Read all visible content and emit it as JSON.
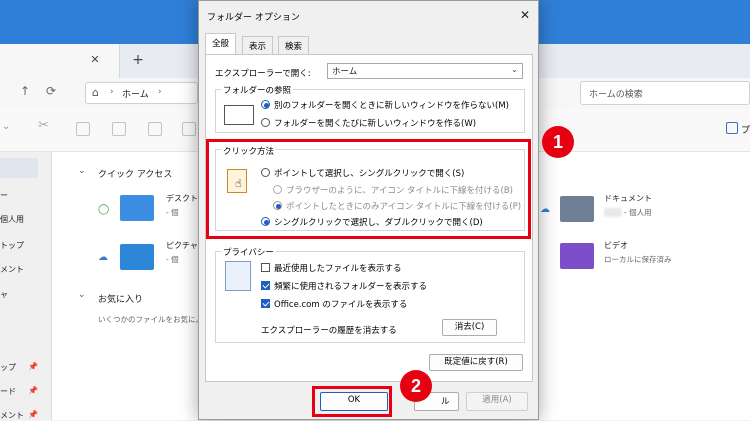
{
  "explorer": {
    "home": "ホーム",
    "search_placeholder": "ホームの検索",
    "sidebar": [
      {
        "label": "ー"
      },
      {
        "label": "個人用"
      },
      {
        "label": "トップ"
      },
      {
        "label": "メント"
      },
      {
        "label": "ャ"
      },
      {
        "label": "ップ"
      },
      {
        "label": "ード"
      },
      {
        "label": "メント"
      }
    ],
    "quick_access": "クイック アクセス",
    "favorites": "お気に入り",
    "favorites_hint": "いくつかのファイルをお気に入りに追加すると、ここに表示されます。",
    "items": {
      "desktop": {
        "name": "デスクトップ",
        "sub": "- 個"
      },
      "pictures": {
        "name": "ピクチャ",
        "sub": "- 個"
      },
      "documents": {
        "name": "ドキュメント",
        "sub": "- 個人用"
      },
      "videos": {
        "name": "ビデオ",
        "sub": "ローカルに保存済み"
      }
    },
    "toolbar_right": "プ"
  },
  "dialog": {
    "title": "フォルダー オプション",
    "tabs": [
      "全般",
      "表示",
      "検索"
    ],
    "open_explorer_label": "エクスプローラーで開く:",
    "open_explorer_value": "ホーム",
    "browse": {
      "title": "フォルダーの参照",
      "options": [
        {
          "label": "別のフォルダーを開くときに新しいウィンドウを作らない(M)",
          "checked": true
        },
        {
          "label": "フォルダーを開くたびに新しいウィンドウを作る(W)",
          "checked": false
        }
      ]
    },
    "click": {
      "title": "クリック方法",
      "options": [
        {
          "label": "ポイントして選択し、シングルクリックで開く(S)",
          "checked": false,
          "disabled": false
        },
        {
          "label": "ブラウザーのように、アイコン タイトルに下線を付ける(B)",
          "checked": false,
          "disabled": true
        },
        {
          "label": "ポイントしたときにのみアイコン タイトルに下線を付ける(P)",
          "checked": true,
          "disabled": true
        },
        {
          "label": "シングルクリックで選択し、ダブルクリックで開く(D)",
          "checked": true,
          "disabled": false
        }
      ]
    },
    "privacy": {
      "title": "プライバシー",
      "options": [
        {
          "label": "最近使用したファイルを表示する",
          "checked": false
        },
        {
          "label": "頻繁に使用されるフォルダーを表示する",
          "checked": true
        },
        {
          "label": "Office.com のファイルを表示する",
          "checked": true
        }
      ],
      "clear_label": "エクスプローラーの履歴を消去する",
      "clear_button": "消去(C)"
    },
    "defaults_button": "既定値に戻す(R)",
    "ok_button": "OK",
    "cancel_button": "ル",
    "apply_button": "適用(A)"
  },
  "annotations": {
    "badge1": "1",
    "badge2": "2",
    "color": "#e60012"
  }
}
